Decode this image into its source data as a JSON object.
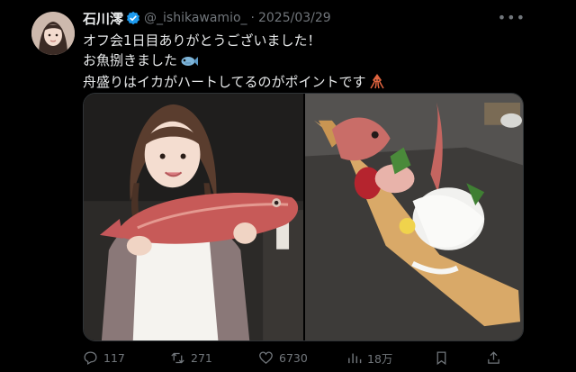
{
  "tweet": {
    "author_name": "石川澪",
    "handle": "@_ishikawamio_",
    "separator": "·",
    "date": "2025/03/29",
    "lines": [
      "オフ会1日目ありがとうございました！",
      "お魚捌きました",
      "舟盛りはイカがハートしてるのがポイントです"
    ],
    "verified_color": "#1d9bf0"
  },
  "media": {
    "left_photo": "woman-holding-red-sea-bream",
    "right_photo": "sashimi-boat-platter"
  },
  "actions": {
    "replies": "117",
    "reposts": "271",
    "likes": "6730",
    "views": "18万"
  },
  "icons": [
    "verified-badge-icon",
    "more-icon",
    "fish-emoji-icon",
    "squid-emoji-icon",
    "reply-icon",
    "repost-icon",
    "like-icon",
    "views-icon",
    "bookmark-icon",
    "share-icon"
  ]
}
